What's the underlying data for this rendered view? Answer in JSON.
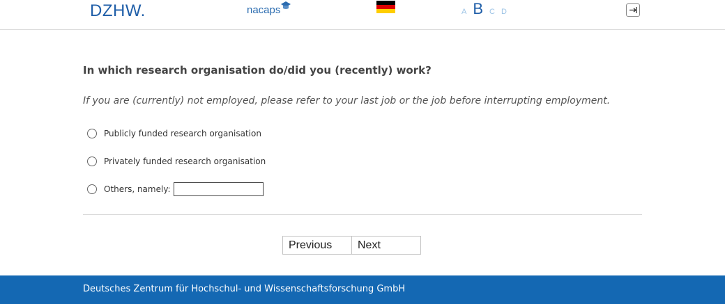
{
  "header": {
    "logo_dzhw": "DZHW.",
    "logo_nacaps": "nacaps",
    "language_flag": "german-flag-icon",
    "font_size_options": [
      "A",
      "B",
      "C",
      "D"
    ],
    "font_size_selected": "B",
    "logout_icon": "logout-icon",
    "colors": {
      "brand": "#1f5ea8",
      "flag_black": "#000000",
      "flag_red": "#dd0000",
      "flag_gold": "#ffce00"
    }
  },
  "survey": {
    "question": "In which research organisation do/did you (recently) work?",
    "instruction": "If you are (currently) not employed, please refer to your last job or the job before interrupting employment.",
    "options": [
      {
        "label": "Publicly funded research organisation",
        "selected": false
      },
      {
        "label": "Privately funded research organisation",
        "selected": false
      },
      {
        "label": "Others, namely:",
        "selected": false,
        "input_value": ""
      }
    ]
  },
  "navigation": {
    "previous_label": "Previous",
    "next_label": "Next"
  },
  "footer": {
    "text": "Deutsches Zentrum für Hochschul- und Wissenschaftsforschung GmbH",
    "background": "#1468b3"
  }
}
